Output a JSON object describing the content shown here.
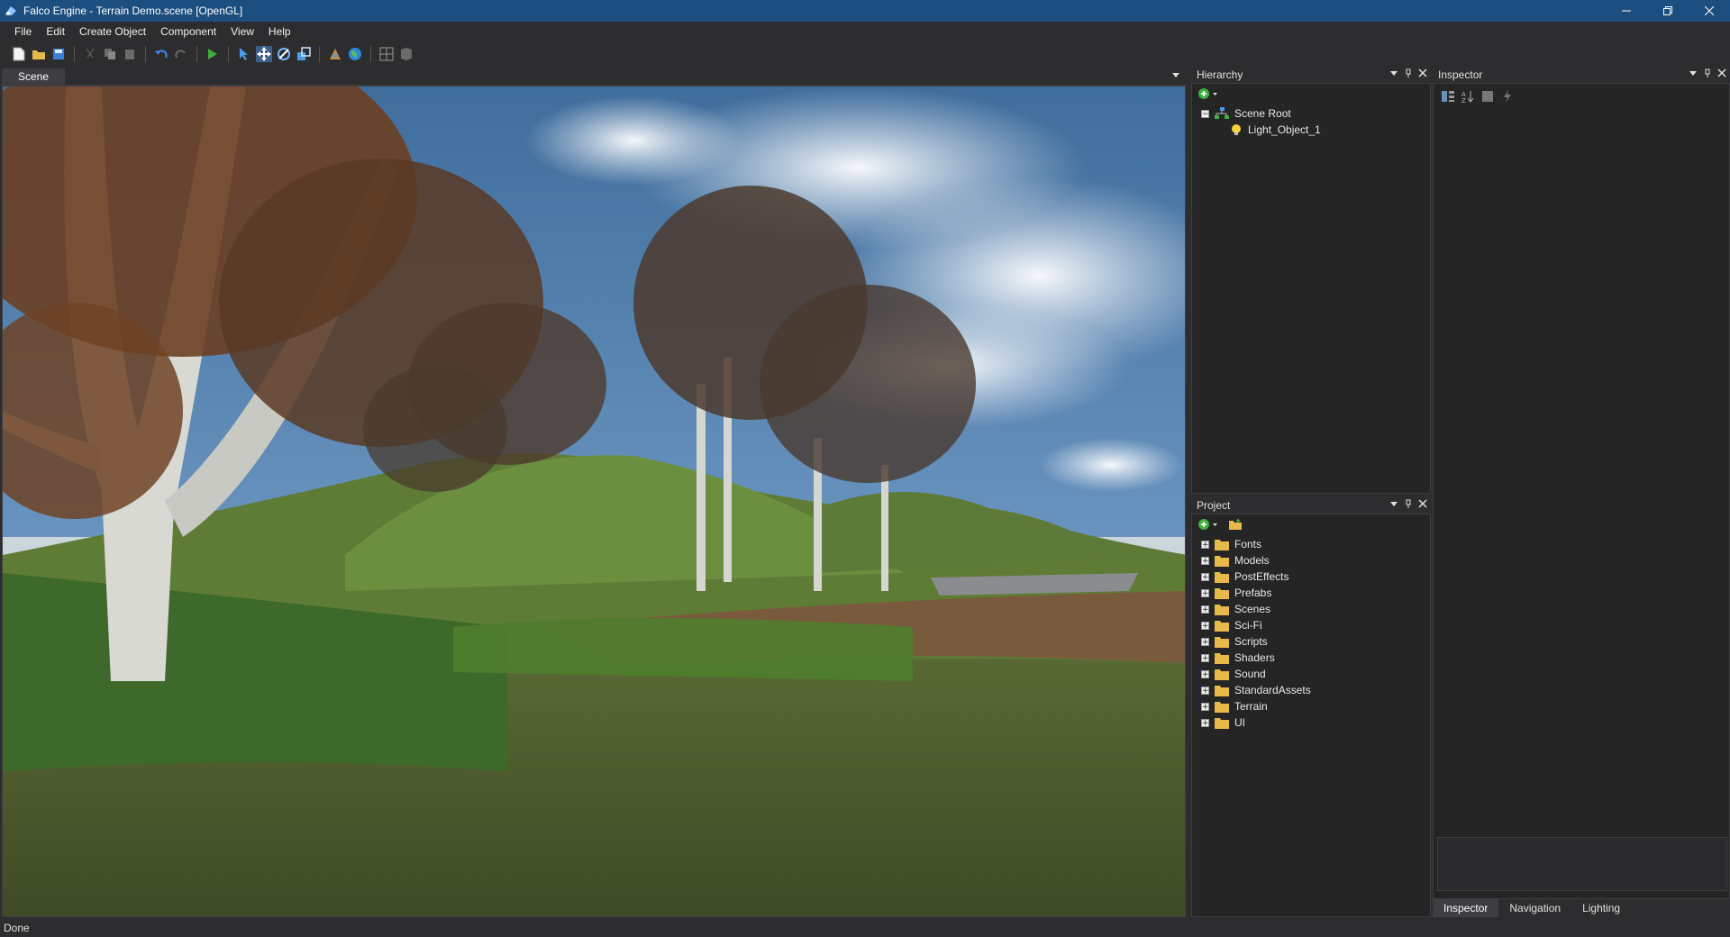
{
  "window": {
    "title": "Falco Engine - Terrain Demo.scene [OpenGL]"
  },
  "menu": [
    "File",
    "Edit",
    "Create Object",
    "Component",
    "View",
    "Help"
  ],
  "scene_tab": {
    "label": "Scene"
  },
  "hierarchy": {
    "title": "Hierarchy",
    "root": "Scene Root",
    "children": [
      "Light_Object_1"
    ]
  },
  "project": {
    "title": "Project",
    "folders": [
      "Fonts",
      "Models",
      "PostEffects",
      "Prefabs",
      "Scenes",
      "Sci-Fi",
      "Scripts",
      "Shaders",
      "Sound",
      "StandardAssets",
      "Terrain",
      "UI"
    ]
  },
  "inspector": {
    "title": "Inspector"
  },
  "bottom_tabs": [
    "Inspector",
    "Navigation",
    "Lighting"
  ],
  "status": {
    "text": "Done"
  },
  "colors": {
    "titlebar": "#1c4e7f",
    "panel": "#252526",
    "chrome": "#2d2d30",
    "accent_green": "#3fae3f"
  }
}
